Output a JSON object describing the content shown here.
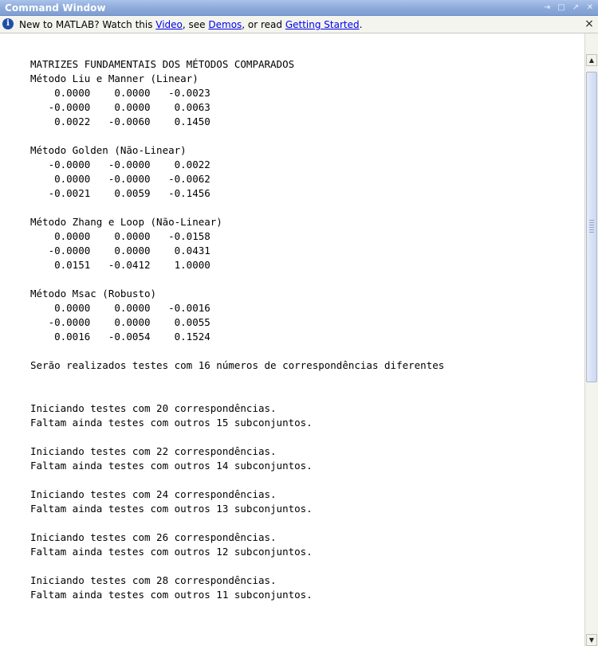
{
  "window": {
    "title": "Command Window",
    "controls": [
      "undock-icon",
      "maximize-icon",
      "help-icon",
      "close-icon"
    ],
    "colors": {
      "titlebar": "#8eabdb",
      "link": "#0000ee",
      "info_icon": "#1f4fa8"
    }
  },
  "infobar": {
    "prefix": "New to MATLAB? Watch this ",
    "video_link": "Video",
    "mid1": ", see ",
    "demos_link": "Demos",
    "mid2": ", or read ",
    "getting_started_link": "Getting Started",
    "suffix": ".",
    "close_glyph": "×"
  },
  "output_text": "MATRIZES FUNDAMENTAIS DOS MÉTODOS COMPARADOS\nMétodo Liu e Manner (Linear)\n    0.0000    0.0000   -0.0023\n   -0.0000    0.0000    0.0063\n    0.0022   -0.0060    0.1450\n\nMétodo Golden (Não-Linear)\n   -0.0000   -0.0000    0.0022\n    0.0000   -0.0000   -0.0062\n   -0.0021    0.0059   -0.1456\n\nMétodo Zhang e Loop (Não-Linear)\n    0.0000    0.0000   -0.0158\n   -0.0000    0.0000    0.0431\n    0.0151   -0.0412    1.0000\n\nMétodo Msac (Robusto)\n    0.0000    0.0000   -0.0016\n   -0.0000    0.0000    0.0055\n    0.0016   -0.0054    0.1524\n\nSerão realizados testes com 16 números de correspondências diferentes\n\n\nIniciando testes com 20 correspondências.\nFaltam ainda testes com outros 15 subconjuntos.\n\nIniciando testes com 22 correspondências.\nFaltam ainda testes com outros 14 subconjuntos.\n\nIniciando testes com 24 correspondências.\nFaltam ainda testes com outros 13 subconjuntos.\n\nIniciando testes com 26 correspondências.\nFaltam ainda testes com outros 12 subconjuntos.\n\nIniciando testes com 28 correspondências.\nFaltam ainda testes com outros 11 subconjuntos."
}
